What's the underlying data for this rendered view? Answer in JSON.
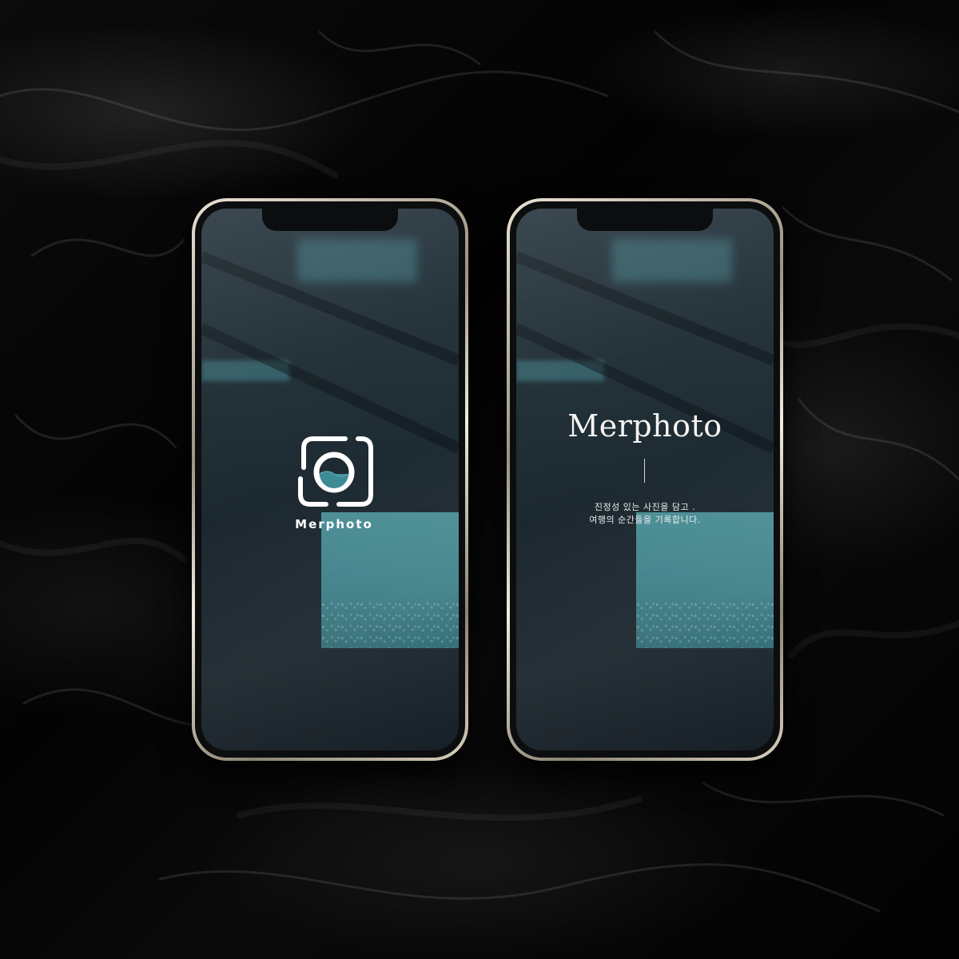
{
  "splash_screen": {
    "brand_name": "Merphoto",
    "logo_icon": "camera-frame-icon"
  },
  "intro_screen": {
    "title": "Merphoto",
    "tagline_line1": "진정성 있는 사진을 담고 .",
    "tagline_line2": "여행의 순간들을 기록합니다."
  },
  "colors": {
    "background": "#050505",
    "screen_base": "#1f2d35",
    "accent_teal": "#4c8f96",
    "text": "#ffffff"
  }
}
